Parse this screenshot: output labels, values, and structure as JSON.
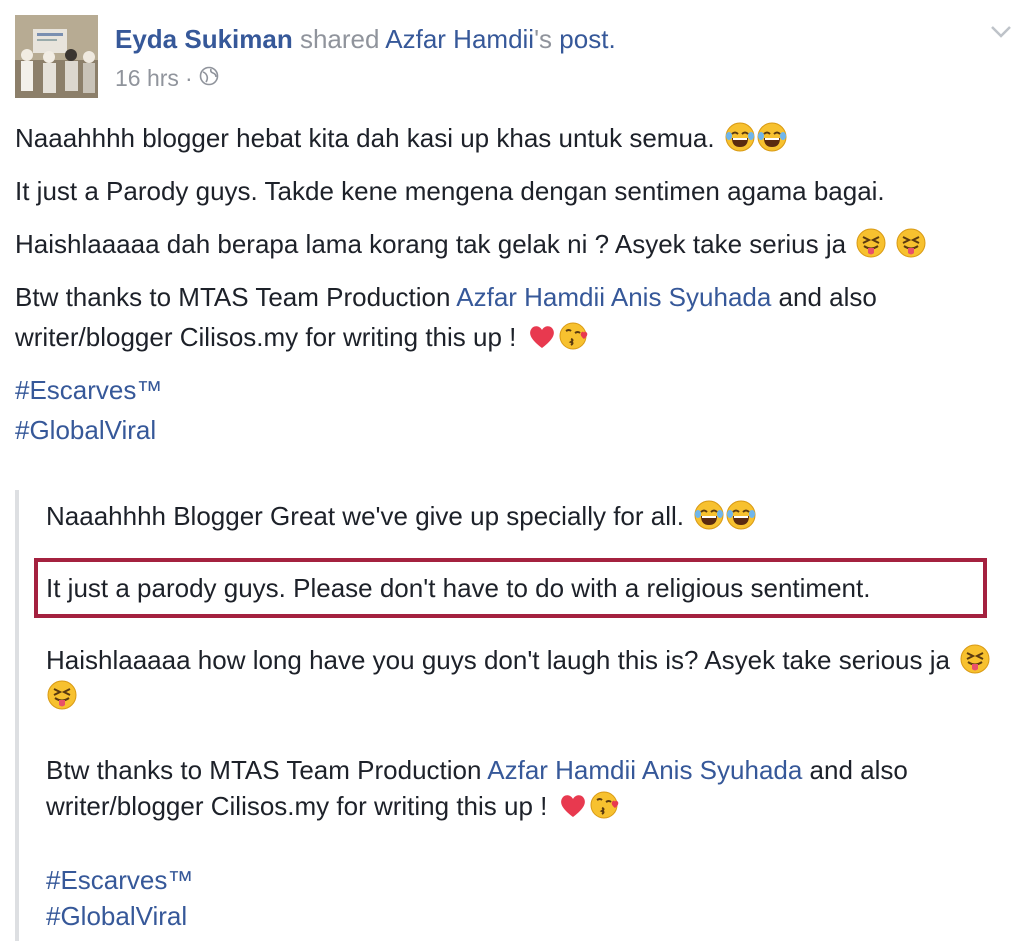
{
  "post": {
    "author": "Eyda Sukiman",
    "shared_word": "shared",
    "original_author": "Azfar Hamdii",
    "possessive": "'s",
    "post_word": "post.",
    "time": "16 hrs",
    "dot": "·"
  },
  "body": {
    "line1": "Naaahhhh blogger hebat kita dah kasi up khas untuk semua.",
    "line2": "It just a Parody guys. Takde kene mengena dengan sentimen agama bagai.",
    "line3": "Haishlaaaaa dah berapa lama korang tak gelak ni ? Asyek take serius ja",
    "line4_pre": "Btw thanks to MTAS Team Production ",
    "line4_link1": "Azfar Hamdii",
    "line4_space": " ",
    "line4_link2": "Anis Syuhada",
    "line4_post": " and also writer/blogger Cilisos.my for writing this up !",
    "hashtag1": "#Escarves™",
    "hashtag2": "#GlobalViral"
  },
  "translation": {
    "line1": "Naaahhhh Blogger Great we've give up specially for all.",
    "line2": "It just a parody guys. Please don't have to do with a religious sentiment.",
    "line3": "Haishlaaaaa how long have you guys don't laugh this is? Asyek take serious ja",
    "line4_pre": "Btw thanks to MTAS Team Production ",
    "line4_link1": "Azfar Hamdii",
    "line4_space": " ",
    "line4_link2": "Anis Syuhada",
    "line4_post": " and also writer/blogger Cilisos.my for writing this up !",
    "hashtag1": "#Escarves™",
    "hashtag2": "#GlobalViral"
  },
  "icons": {
    "globe": "globe-icon",
    "chevron": "chevron-down-icon",
    "laugh": "tears-of-joy-emoji",
    "tongue": "tongue-wink-emoji",
    "heart": "red-heart-emoji",
    "kiss": "blowing-kiss-emoji"
  },
  "colors": {
    "link": "#365899",
    "meta": "#90949c",
    "text": "#1d2129",
    "highlight_border": "#a4213f",
    "quote_border": "#dddfe2"
  }
}
